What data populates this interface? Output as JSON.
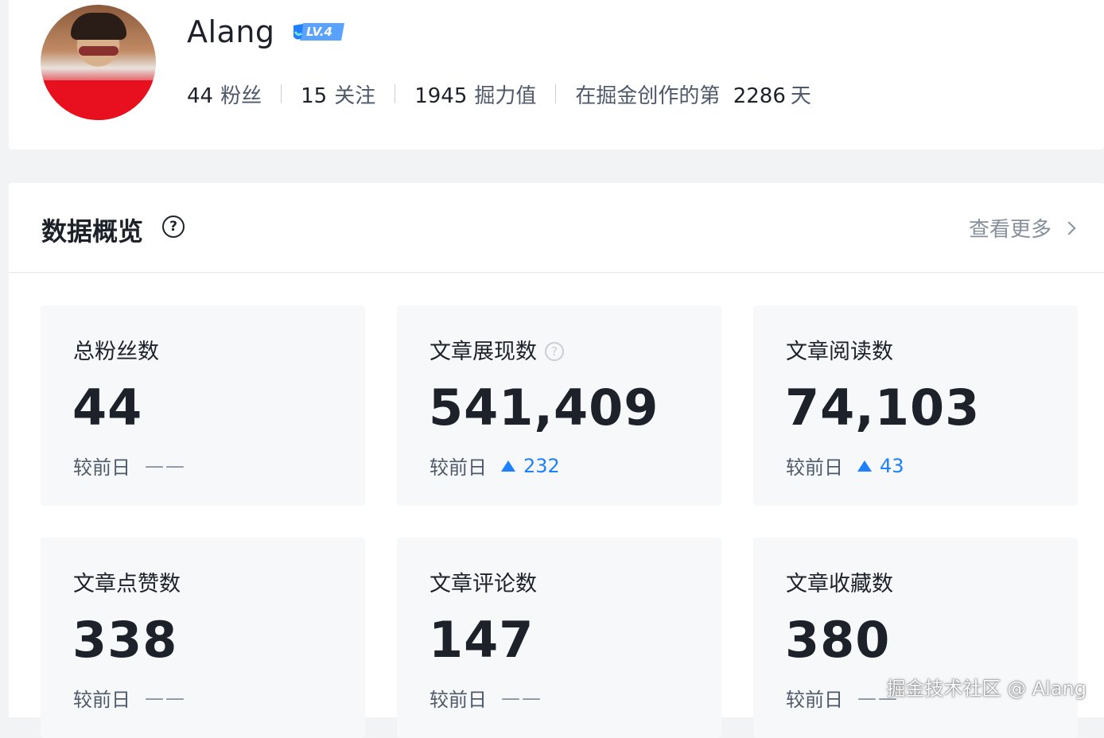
{
  "profile": {
    "username": "Alang",
    "level": "LV.4",
    "stats": [
      {
        "value": "44",
        "label": "粉丝"
      },
      {
        "value": "15",
        "label": "关注"
      },
      {
        "value": "1945",
        "label": "掘力值"
      }
    ],
    "creation_prefix": "在掘金创作的第",
    "creation_days": "2286",
    "creation_suffix": "天"
  },
  "overview": {
    "title": "数据概览",
    "help_glyph": "?",
    "view_more": "查看更多",
    "compare_label": "较前日",
    "cards": [
      {
        "label": "总粉丝数",
        "value": "44",
        "trend": "flat",
        "change": "——"
      },
      {
        "label": "文章展现数",
        "value": "541,409",
        "trend": "up",
        "change": "232"
      },
      {
        "label": "文章阅读数",
        "value": "74,103",
        "trend": "up",
        "change": "43"
      },
      {
        "label": "文章点赞数",
        "value": "338",
        "trend": "flat",
        "change": "——"
      },
      {
        "label": "文章评论数",
        "value": "147",
        "trend": "flat",
        "change": "——"
      },
      {
        "label": "文章收藏数",
        "value": "380",
        "trend": "flat",
        "change": "——"
      }
    ]
  },
  "watermark": "掘金技术社区 @ Alang",
  "colors": {
    "accent": "#1e80ff",
    "card_bg": "#f7f8fa",
    "page_bg": "#f2f3f5",
    "text_primary": "#1d2129",
    "text_secondary": "#4e5969"
  }
}
